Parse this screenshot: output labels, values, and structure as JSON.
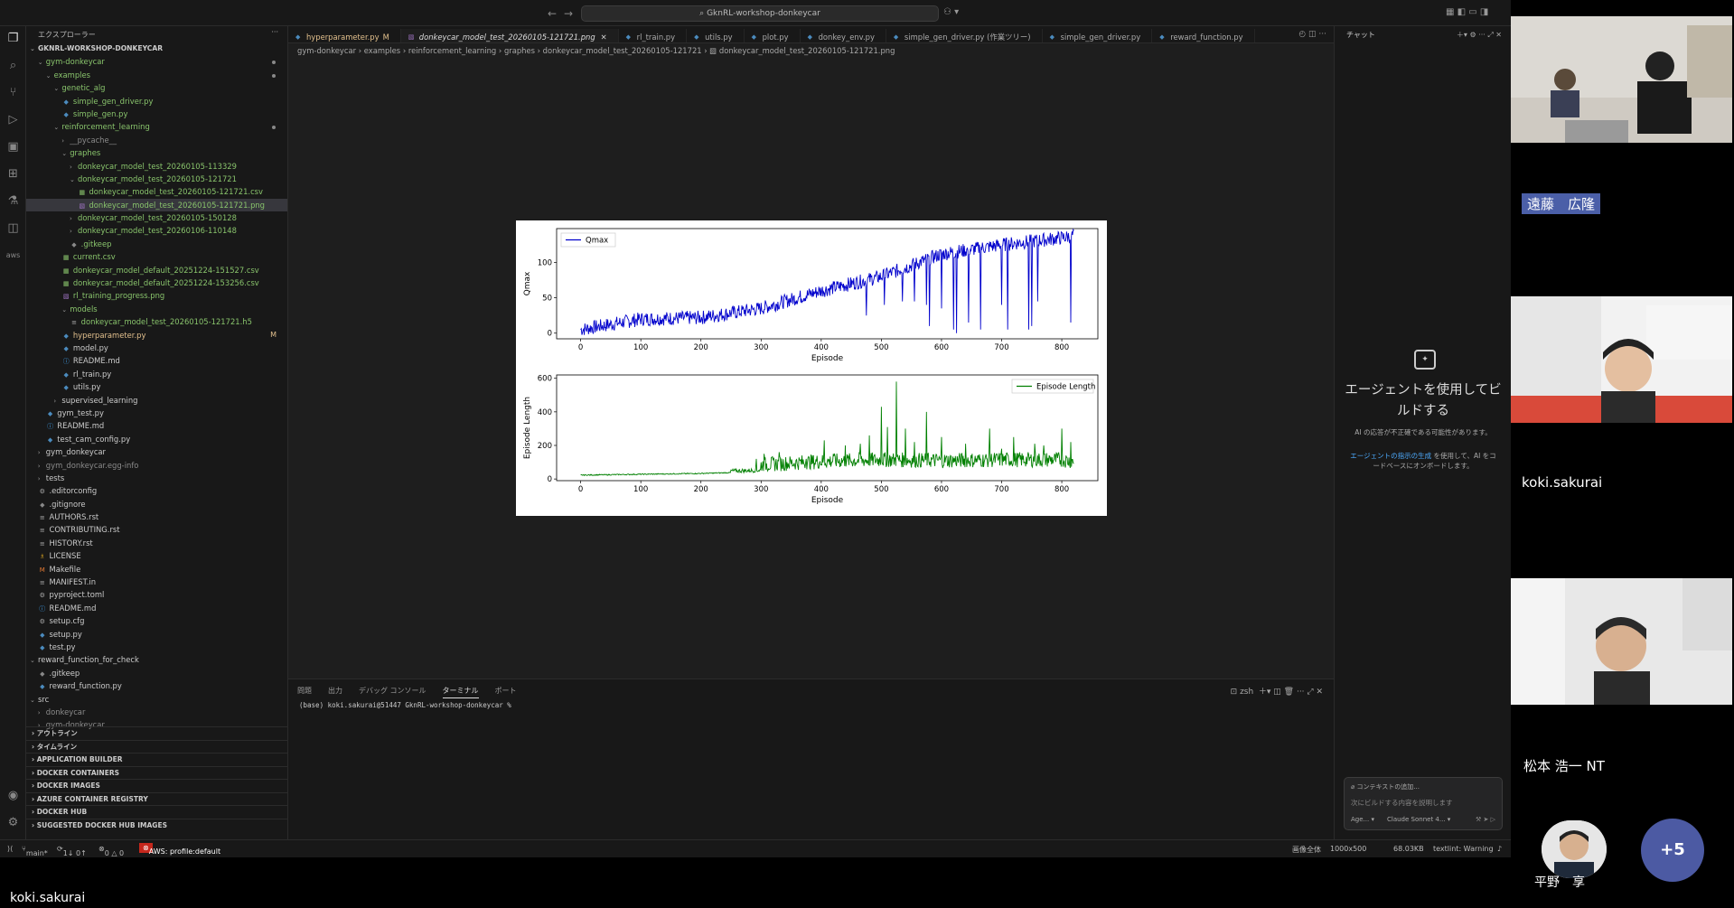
{
  "titlebar": {
    "search": "GknRL-workshop-donkeycar"
  },
  "sidebar": {
    "title": "エクスプローラー",
    "tree": [
      {
        "label": "GKNRL-WORKSHOP-DONKEYCAR",
        "d": 0,
        "chev": "open",
        "bold": true
      },
      {
        "label": "gym-donkeycar",
        "d": 1,
        "chev": "open",
        "c": "green",
        "dot": true
      },
      {
        "label": "examples",
        "d": 2,
        "chev": "open",
        "c": "green",
        "dot": true
      },
      {
        "label": "genetic_alg",
        "d": 3,
        "chev": "open",
        "c": "green"
      },
      {
        "label": "simple_gen_driver.py",
        "d": 4,
        "icon": "py",
        "c": "green"
      },
      {
        "label": "simple_gen.py",
        "d": 4,
        "icon": "py",
        "c": "green"
      },
      {
        "label": "reinforcement_learning",
        "d": 3,
        "chev": "open",
        "c": "green",
        "dot": true
      },
      {
        "label": "__pycache__",
        "d": 4,
        "chev": "closed",
        "c": "dim"
      },
      {
        "label": "graphes",
        "d": 4,
        "chev": "open",
        "c": "green"
      },
      {
        "label": "donkeycar_model_test_20260105-113329",
        "d": 5,
        "chev": "closed",
        "c": "green"
      },
      {
        "label": "donkeycar_model_test_20260105-121721",
        "d": 5,
        "chev": "open",
        "c": "green"
      },
      {
        "label": "donkeycar_model_test_20260105-121721.csv",
        "d": 6,
        "icon": "csv",
        "c": "green"
      },
      {
        "label": "donkeycar_model_test_20260105-121721.png",
        "d": 6,
        "icon": "img",
        "c": "green",
        "sel": true
      },
      {
        "label": "donkeycar_model_test_20260105-150128",
        "d": 5,
        "chev": "closed",
        "c": "green"
      },
      {
        "label": "donkeycar_model_test_20260106-110148",
        "d": 5,
        "chev": "closed",
        "c": "green"
      },
      {
        "label": ".gitkeep",
        "d": 5,
        "icon": "git",
        "c": "green"
      },
      {
        "label": "current.csv",
        "d": 4,
        "icon": "csv",
        "c": "green"
      },
      {
        "label": "donkeycar_model_default_20251224-151527.csv",
        "d": 4,
        "icon": "csv",
        "c": "green"
      },
      {
        "label": "donkeycar_model_default_20251224-153256.csv",
        "d": 4,
        "icon": "csv",
        "c": "green"
      },
      {
        "label": "rl_training_progress.png",
        "d": 4,
        "icon": "img",
        "c": "green"
      },
      {
        "label": "models",
        "d": 4,
        "chev": "open",
        "c": "green"
      },
      {
        "label": "donkeycar_model_test_20260105-121721.h5",
        "d": 5,
        "icon": "file",
        "c": "green"
      },
      {
        "label": "hyperparameter.py",
        "d": 4,
        "icon": "py",
        "c": "yellow",
        "badge": "M"
      },
      {
        "label": "model.py",
        "d": 4,
        "icon": "py"
      },
      {
        "label": "README.md",
        "d": 4,
        "icon": "info"
      },
      {
        "label": "rl_train.py",
        "d": 4,
        "icon": "py"
      },
      {
        "label": "utils.py",
        "d": 4,
        "icon": "py"
      },
      {
        "label": "supervised_learning",
        "d": 3,
        "chev": "closed"
      },
      {
        "label": "gym_test.py",
        "d": 2,
        "icon": "py"
      },
      {
        "label": "README.md",
        "d": 2,
        "icon": "info"
      },
      {
        "label": "test_cam_config.py",
        "d": 2,
        "icon": "py"
      },
      {
        "label": "gym_donkeycar",
        "d": 1,
        "chev": "closed"
      },
      {
        "label": "gym_donkeycar.egg-info",
        "d": 1,
        "chev": "closed",
        "c": "dim"
      },
      {
        "label": "tests",
        "d": 1,
        "chev": "closed"
      },
      {
        "label": ".editorconfig",
        "d": 1,
        "icon": "gear"
      },
      {
        "label": ".gitignore",
        "d": 1,
        "icon": "git"
      },
      {
        "label": "AUTHORS.rst",
        "d": 1,
        "icon": "txt"
      },
      {
        "label": "CONTRIBUTING.rst",
        "d": 1,
        "icon": "txt"
      },
      {
        "label": "HISTORY.rst",
        "d": 1,
        "icon": "txt"
      },
      {
        "label": "LICENSE",
        "d": 1,
        "icon": "lic"
      },
      {
        "label": "Makefile",
        "d": 1,
        "icon": "mk"
      },
      {
        "label": "MANIFEST.in",
        "d": 1,
        "icon": "txt"
      },
      {
        "label": "pyproject.toml",
        "d": 1,
        "icon": "gear"
      },
      {
        "label": "README.md",
        "d": 1,
        "icon": "info"
      },
      {
        "label": "setup.cfg",
        "d": 1,
        "icon": "gear"
      },
      {
        "label": "setup.py",
        "d": 1,
        "icon": "py"
      },
      {
        "label": "test.py",
        "d": 1,
        "icon": "py"
      },
      {
        "label": "reward_function_for_check",
        "d": 0,
        "chev": "open"
      },
      {
        "label": ".gitkeep",
        "d": 1,
        "icon": "git"
      },
      {
        "label": "reward_function.py",
        "d": 1,
        "icon": "py"
      },
      {
        "label": "src",
        "d": 0,
        "chev": "open"
      },
      {
        "label": "donkeycar",
        "d": 1,
        "chev": "closed",
        "c": "dim"
      },
      {
        "label": "gym-donkeycar",
        "d": 1,
        "chev": "closed",
        "c": "dim"
      }
    ],
    "sections": [
      "アウトライン",
      "タイムライン",
      "APPLICATION BUILDER",
      "DOCKER CONTAINERS",
      "DOCKER IMAGES",
      "AZURE CONTAINER REGISTRY",
      "DOCKER HUB",
      "SUGGESTED DOCKER HUB IMAGES"
    ]
  },
  "tabs": [
    {
      "label": "hyperparameter.py",
      "suffix": "M",
      "mod": true
    },
    {
      "label": "donkeycar_model_test_20260105-121721.png",
      "active": true
    },
    {
      "label": "rl_train.py"
    },
    {
      "label": "utils.py"
    },
    {
      "label": "plot.py"
    },
    {
      "label": "donkey_env.py"
    },
    {
      "label": "simple_gen_driver.py (作業ツリー)"
    },
    {
      "label": "simple_gen_driver.py"
    },
    {
      "label": "reward_function.py"
    }
  ],
  "breadcrumb": [
    "gym-donkeycar",
    "examples",
    "reinforcement_learning",
    "graphes",
    "donkeycar_model_test_20260105-121721",
    "donkeycar_model_test_20260105-121721.png"
  ],
  "chart_data": [
    {
      "type": "line",
      "xlabel": "Episode",
      "ylabel": "Qmax",
      "xlim": [
        -40,
        860
      ],
      "ylim": [
        -8,
        148
      ],
      "xticks": [
        0,
        100,
        200,
        300,
        400,
        500,
        600,
        700,
        800
      ],
      "yticks": [
        0,
        50,
        100
      ],
      "legend": "top-left",
      "series": [
        {
          "name": "Qmax",
          "color": "#0000cc"
        }
      ],
      "trend_x": [
        0,
        100,
        200,
        300,
        400,
        500,
        600,
        700,
        800,
        820
      ],
      "trend_y": [
        5,
        20,
        22,
        35,
        60,
        80,
        112,
        125,
        135,
        138
      ],
      "dips_x": [
        475,
        505,
        535,
        555,
        575,
        580,
        600,
        620,
        625,
        645,
        665,
        700,
        710,
        745,
        750,
        760,
        815
      ],
      "dips_y": [
        25,
        40,
        45,
        45,
        40,
        10,
        35,
        5,
        0,
        15,
        5,
        40,
        5,
        5,
        10,
        45,
        15
      ]
    },
    {
      "type": "line",
      "xlabel": "Episode",
      "ylabel": "Episode Length",
      "xlim": [
        -40,
        860
      ],
      "ylim": [
        -10,
        620
      ],
      "xticks": [
        0,
        100,
        200,
        300,
        400,
        500,
        600,
        700,
        800
      ],
      "yticks": [
        0,
        200,
        400,
        600
      ],
      "legend": "top-right",
      "series": [
        {
          "name": "Episode Length",
          "color": "#008000"
        }
      ],
      "base_x": [
        0,
        100,
        200,
        300,
        400,
        500,
        600,
        700,
        800,
        820
      ],
      "base_y": [
        20,
        25,
        30,
        40,
        60,
        70,
        65,
        70,
        70,
        60
      ],
      "spikes_x": [
        292,
        305,
        330,
        375,
        405,
        420,
        440,
        465,
        480,
        500,
        510,
        525,
        540,
        555,
        575,
        600,
        640,
        680,
        700,
        720,
        755,
        770,
        800,
        815
      ],
      "spikes_y": [
        120,
        150,
        160,
        120,
        230,
        150,
        200,
        210,
        260,
        430,
        310,
        580,
        300,
        220,
        400,
        250,
        210,
        300,
        180,
        250,
        210,
        200,
        300,
        220
      ]
    }
  ],
  "panel": {
    "tabs": [
      "問題",
      "出力",
      "デバッグ コンソール",
      "ターミナル",
      "ポート"
    ],
    "shell": "zsh",
    "prompt": "(base) koki.sakurai@51447 GknRL-workshop-donkeycar %"
  },
  "chat": {
    "title": "チャット",
    "heading": "エージェントを使用してビルドする",
    "warning": "AI の応答が不正確である可能性があります。",
    "link": "エージェントの指示の生成",
    "link_rest": "を使用して、AI をコードベースにオンボードします。",
    "context": "コンテキストの追加...",
    "placeholder": "次にビルドする内容を説明します",
    "mode": "Age...",
    "model": "Claude Sonnet 4..."
  },
  "status": {
    "branch": "main*",
    "sync": "1↓ 0↑",
    "problems": "0 △ 0",
    "aws": "AWS: profile:default",
    "zoom": "画像全体",
    "dims": "1000x500",
    "size": "68.03KB",
    "lint": "textlint: Warning"
  },
  "participants": {
    "p1": "遠藤　広隆",
    "p2": "koki.sakurai",
    "p3": "松本 浩一 NT",
    "p4": "平野　享",
    "more": "+5"
  },
  "speaker": "koki.sakurai"
}
